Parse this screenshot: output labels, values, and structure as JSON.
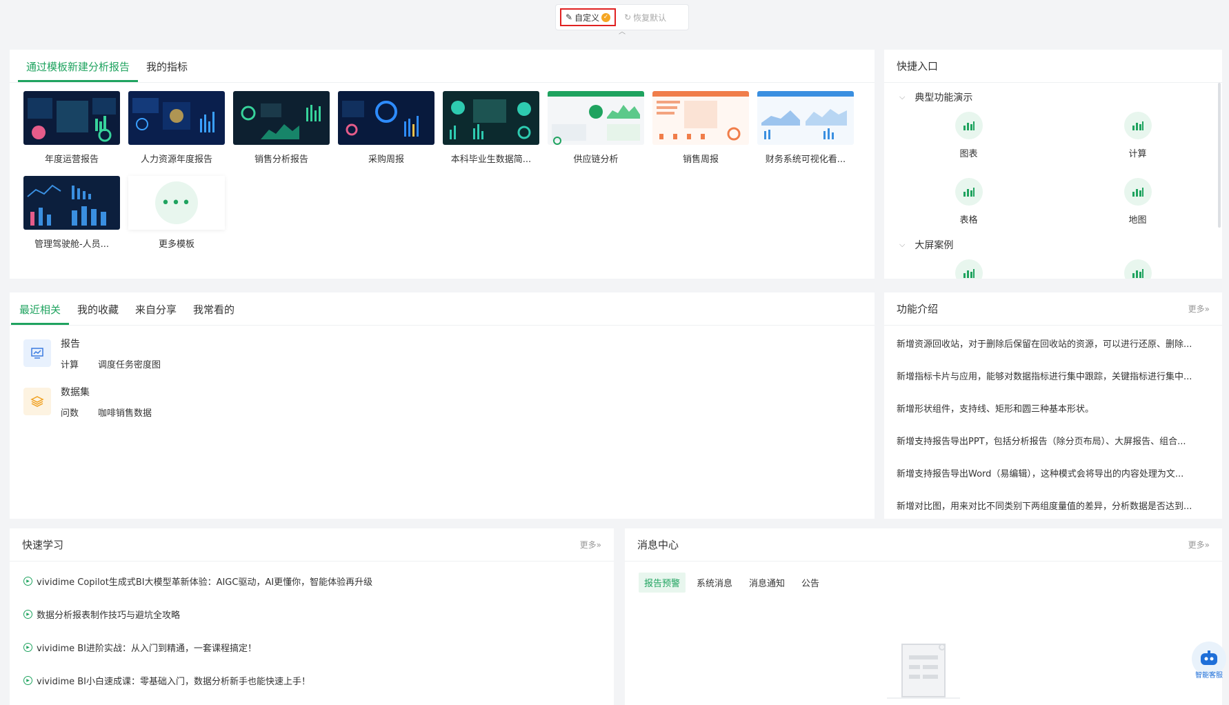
{
  "toolbar": {
    "custom_label": "自定义",
    "restore_label": "恢复默认"
  },
  "templates": {
    "tabs": [
      "通过模板新建分析报告",
      "我的指标"
    ],
    "items": [
      "年度运营报告",
      "人力资源年度报告",
      "销售分析报告",
      "采购周报",
      "本科毕业生数据简...",
      "供应链分析",
      "销售周报",
      "财务系统可视化看...",
      "管理驾驶舱-人员..."
    ],
    "more_label": "更多模板"
  },
  "quick_entry": {
    "title": "快捷入口",
    "groups": [
      {
        "title": "典型功能演示",
        "items": [
          "图表",
          "计算",
          "表格",
          "地图"
        ]
      },
      {
        "title": "大屏案例"
      }
    ]
  },
  "recent": {
    "tabs": [
      "最近相关",
      "我的收藏",
      "来自分享",
      "我常看的"
    ],
    "items": [
      {
        "title": "报告",
        "type": "计算",
        "name": "调度任务密度图",
        "color": "#e8f1fd"
      },
      {
        "title": "数据集",
        "type": "问数",
        "name": "咖啡销售数据",
        "color": "#fdf3e1"
      }
    ]
  },
  "features": {
    "title": "功能介绍",
    "more": "更多»",
    "items": [
      "新增资源回收站，对于删除后保留在回收站的资源，可以进行还原、删除...",
      "新增指标卡片与应用，能够对数据指标进行集中跟踪，关键指标进行集中...",
      "新增形状组件，支持线、矩形和圆三种基本形状。",
      "新增支持报告导出PPT，包括分析报告（除分页布局）、大屏报告、组合...",
      "新增支持报告导出Word（易编辑），这种模式会将导出的内容处理为文...",
      "新增对比图，用来对比不同类别下两组度量值的差异，分析数据是否达到..."
    ]
  },
  "learning": {
    "title": "快速学习",
    "more": "更多»",
    "items": [
      "vividime Copilot生成式BI大模型革新体验：AIGC驱动，AI更懂你，智能体验再升级",
      "数据分析报表制作技巧与避坑全攻略",
      "vividime BI进阶实战：从入门到精通，一套课程搞定！",
      "vividime BI小白速成课：零基础入门，数据分析新手也能快速上手！"
    ]
  },
  "messages": {
    "title": "消息中心",
    "more": "更多»",
    "tabs": [
      "报告预警",
      "系统消息",
      "消息通知",
      "公告"
    ]
  },
  "bot": {
    "label": "智能客服"
  },
  "colors": {
    "accent": "#1fa35f",
    "highlight": "#e02020"
  }
}
